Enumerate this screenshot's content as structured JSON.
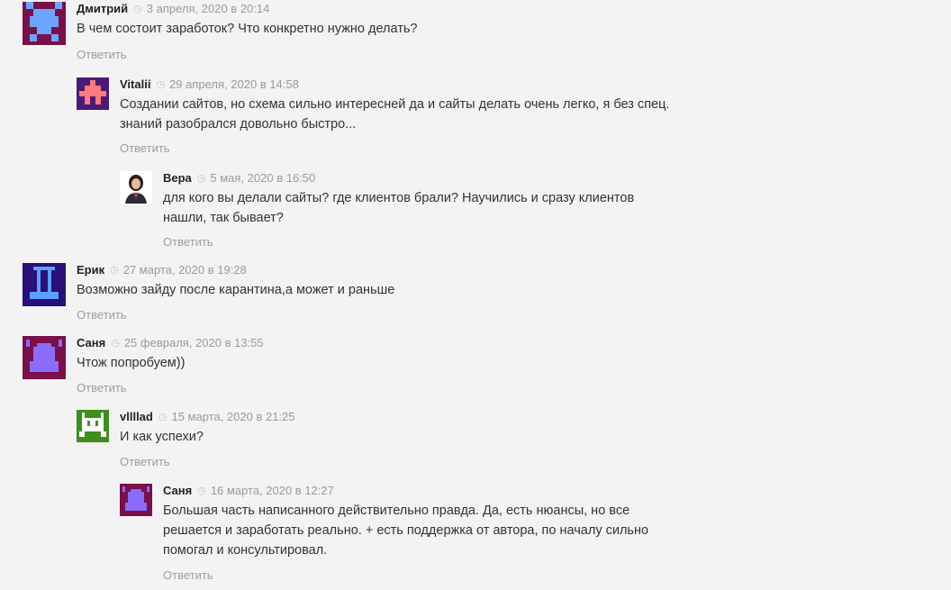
{
  "comments": [
    {
      "author": "Дмитрий",
      "date": "3 апреля, 2020 в 20:14",
      "text": [
        "В чем состоит заработок? Что конкретно нужно делать?"
      ],
      "reply": "Ответить",
      "avatar": {
        "bg": "#7a1048",
        "fg": "#6aa6ff"
      }
    },
    {
      "author": "Vitalii",
      "date": "29 апреля, 2020 в 14:58",
      "text": [
        "Создании сайтов, но схема сильно интересней да и сайты делать очень легко, я без спец.",
        "знаний разобрался довольно быстро..."
      ],
      "reply": "Ответить",
      "avatar": {
        "bg": "#4a1a7a",
        "fg": "#ff7a7a"
      }
    },
    {
      "author": "Вера",
      "date": "5 мая, 2020 в 16:50",
      "text": [
        "для кого вы делали сайты? где клиентов брали? Научились и сразу клиентов",
        "нашли, так бывает?"
      ],
      "reply": "Ответить",
      "avatar": {
        "bg": "#ffffff",
        "fg": "#2a2a3a"
      }
    },
    {
      "author": "Ерик",
      "date": "27 марта, 2020 в 19:28",
      "text": [
        "Возможно зайду после карантина,а может и раньше"
      ],
      "reply": "Ответить",
      "avatar": {
        "bg": "#2a0e7a",
        "fg": "#5aa0ff"
      }
    },
    {
      "author": "Саня",
      "date": "25 февраля, 2020 в 13:55",
      "text": [
        "Чтож попробуем))"
      ],
      "reply": "Ответить",
      "avatar": {
        "bg": "#7a1048",
        "fg": "#8a6cff"
      }
    },
    {
      "author": "vllllad",
      "date": "15 марта, 2020 в 21:25",
      "text": [
        "И как успехи?"
      ],
      "reply": "Ответить",
      "avatar": {
        "bg": "#3e8e1e",
        "fg": "#ffffff"
      }
    },
    {
      "author": "Саня",
      "date": "16 марта, 2020 в 12:27",
      "text": [
        "Большая часть написанного действительно правда. Да, есть нюансы, но все",
        "решается и заработать реально. + есть поддержка от автора, по началу сильно",
        "помогал и консультировал."
      ],
      "reply": "Ответить",
      "avatar": {
        "bg": "#7a1048",
        "fg": "#8a6cff"
      }
    }
  ],
  "icons": {
    "clock": "clock-icon"
  }
}
